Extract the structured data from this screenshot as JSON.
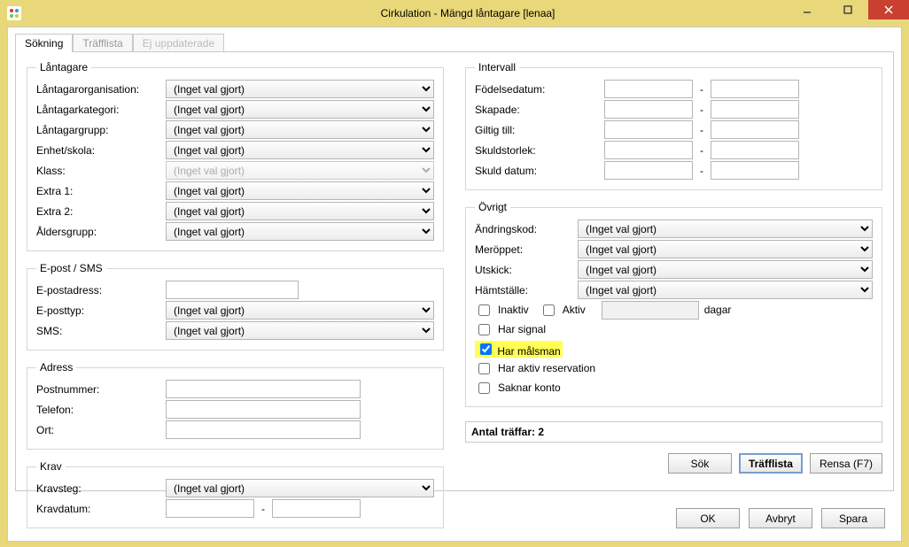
{
  "title": "Cirkulation - Mängd låntagare [lenaa]",
  "tabs": {
    "sokning": "Sökning",
    "trafflista": "Träfflista",
    "ej_uppdaterade": "Ej uppdaterade"
  },
  "no_choice": "(Inget val gjort)",
  "lantagare": {
    "legend": "Låntagare",
    "organisation": "Låntagarorganisation:",
    "kategori": "Låntagarkategori:",
    "grupp": "Låntagargrupp:",
    "enhet": "Enhet/skola:",
    "klass": "Klass:",
    "extra1": "Extra 1:",
    "extra2": "Extra 2:",
    "alder": "Åldersgrupp:"
  },
  "epost": {
    "legend": "E-post / SMS",
    "adress": "E-postadress:",
    "typ": "E-posttyp:",
    "sms": "SMS:"
  },
  "adress": {
    "legend": "Adress",
    "postnr": "Postnummer:",
    "telefon": "Telefon:",
    "ort": "Ort:"
  },
  "krav": {
    "legend": "Krav",
    "steg": "Kravsteg:",
    "datum": "Kravdatum:"
  },
  "intervall": {
    "legend": "Intervall",
    "fodelsedatum": "Födelsedatum:",
    "skapade": "Skapade:",
    "giltig": "Giltig till:",
    "skuldstorlek": "Skuldstorlek:",
    "skulddatum": "Skuld datum:"
  },
  "ovrigt": {
    "legend": "Övrigt",
    "andringskod": "Ändringskod:",
    "meroppet": "Meröppet:",
    "utskick": "Utskick:",
    "hamtstalle": "Hämtställe:",
    "inaktiv": "Inaktiv",
    "aktiv": "Aktiv",
    "dagar": "dagar",
    "har_signal": "Har signal",
    "har_malsman": "Har målsman",
    "har_aktiv_res": "Har aktiv reservation",
    "saknar_konto": "Saknar konto"
  },
  "result_label": "Antal träffar: 2",
  "buttons": {
    "sok": "Sök",
    "trafflista": "Träfflista",
    "rensa": "Rensa (F7)",
    "ok": "OK",
    "avbryt": "Avbryt",
    "spara": "Spara"
  }
}
